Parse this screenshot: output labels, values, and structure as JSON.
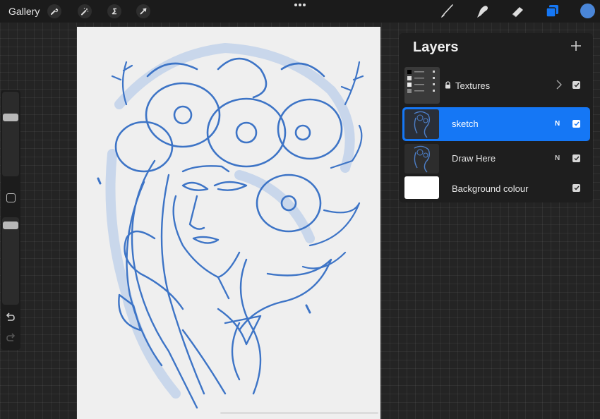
{
  "topbar": {
    "gallery_label": "Gallery",
    "left_tools": [
      {
        "name": "actions",
        "icon": "wrench-icon"
      },
      {
        "name": "adjustments",
        "icon": "magic-wand-icon"
      },
      {
        "name": "selection",
        "icon": "selection-s-icon"
      },
      {
        "name": "transform",
        "icon": "arrow-cursor-icon"
      }
    ],
    "right_tools": [
      {
        "name": "brush",
        "icon": "brush-icon"
      },
      {
        "name": "smudge",
        "icon": "smudge-finger-icon"
      },
      {
        "name": "eraser",
        "icon": "eraser-icon"
      },
      {
        "name": "layers",
        "icon": "layers-icon",
        "active": true
      }
    ],
    "current_color": "#4a86d8",
    "accent_color": "#1577f5"
  },
  "sidebar": {
    "brush_size": 0.72,
    "brush_opacity": 0.95,
    "undo_label": "undo",
    "redo_label": "redo"
  },
  "layers_panel": {
    "title": "Layers",
    "layers": [
      {
        "name": "Textures",
        "type": "group",
        "locked": true,
        "visible": true,
        "blend": "",
        "selected": false
      },
      {
        "name": "sketch",
        "type": "layer",
        "locked": false,
        "visible": true,
        "blend": "N",
        "selected": true
      },
      {
        "name": "Draw Here",
        "type": "layer",
        "locked": false,
        "visible": true,
        "blend": "N",
        "selected": false
      },
      {
        "name": "Background colour",
        "type": "background",
        "locked": false,
        "visible": true,
        "blend": "",
        "selected": false
      }
    ]
  },
  "canvas": {
    "ink_color": "#3d74c6",
    "paper_color": "#efefef"
  }
}
